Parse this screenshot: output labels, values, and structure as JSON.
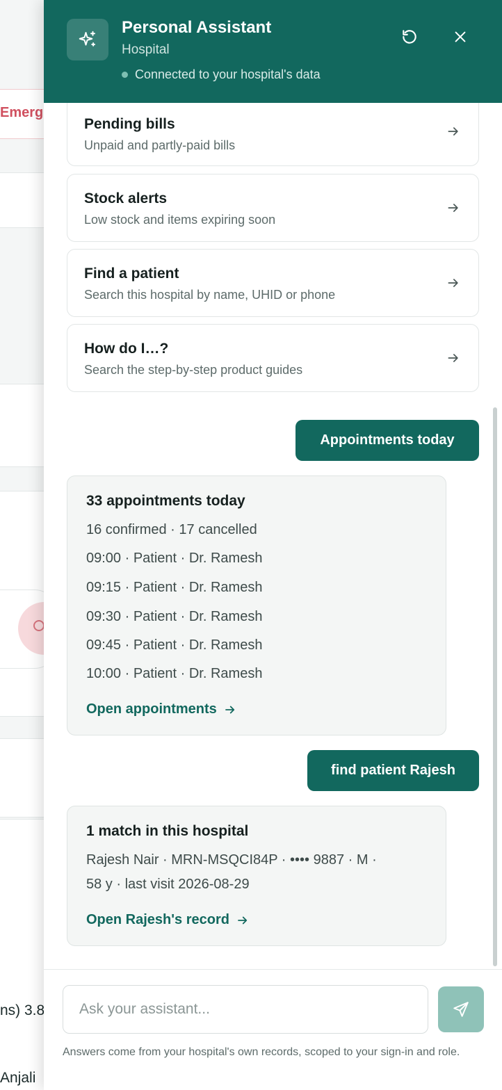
{
  "background": {
    "emergency_label": "Emerge",
    "snippet_1": "ns) 3.8",
    "snippet_2": "Anjali"
  },
  "header": {
    "title": "Personal Assistant",
    "subtitle": "Hospital",
    "status": "Connected to your hospital's data",
    "icons": {
      "brand": "sparkles-icon",
      "refresh": "refresh-icon",
      "close": "close-icon"
    }
  },
  "quick_actions": [
    {
      "title": "Pending bills",
      "description": "Unpaid and partly-paid bills"
    },
    {
      "title": "Stock alerts",
      "description": "Low stock and items expiring soon"
    },
    {
      "title": "Find a patient",
      "description": "Search this hospital by name, UHID or phone"
    },
    {
      "title": "How do I…?",
      "description": "Search the step-by-step product guides"
    }
  ],
  "conversation": {
    "user_1": "Appointments today",
    "reply_1": {
      "title": "33 appointments today",
      "summary": "16 confirmed · 17 cancelled",
      "lines": [
        "09:00 · Patient · Dr. Ramesh",
        "09:15 · Patient · Dr. Ramesh",
        "09:30 · Patient · Dr. Ramesh",
        "09:45 · Patient · Dr. Ramesh",
        "10:00 · Patient · Dr. Ramesh"
      ],
      "link": "Open appointments"
    },
    "user_2": "find patient Rajesh",
    "reply_2": {
      "title": "1 match in this hospital",
      "line_1": "Rajesh Nair · MRN-MSQCI84P · •••• 9887 · M ·",
      "line_2": "58 y · last visit 2026-08-29",
      "link": "Open Rajesh's record"
    }
  },
  "composer": {
    "placeholder": "Ask your assistant...",
    "send_icon": "send-icon",
    "disclaimer": "Answers come from your hospital's own records, scoped to your sign-in and role."
  },
  "colors": {
    "brand": "#12685e",
    "send_disabled": "#8fc2b8",
    "emergency": "#d0505f"
  }
}
